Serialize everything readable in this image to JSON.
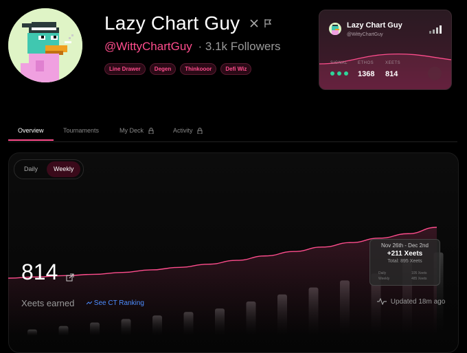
{
  "profile": {
    "name": "Lazy Chart Guy",
    "handle": "@WittyChartGuy",
    "followers": "· 3.1k Followers",
    "tags": [
      "Line Drawer",
      "Degen",
      "Thinkooor",
      "Defi Wiz"
    ],
    "icons": [
      "x-icon",
      "flag-icon"
    ]
  },
  "card": {
    "name": "Lazy Chart Guy",
    "handle": "@WittyChartGuy",
    "labels": {
      "signal": "SIGNAL",
      "ethos": "ETHOS",
      "xeets": "XEETS"
    },
    "ethos": "1368",
    "xeets": "814",
    "colors": {
      "signal": "#2fd59a",
      "accent": "#ff4d8d"
    }
  },
  "tabs": [
    {
      "label": "Overview",
      "active": true
    },
    {
      "label": "Tournaments",
      "active": false
    },
    {
      "label": "My Deck",
      "locked": true
    },
    {
      "label": "Activity",
      "locked": true
    }
  ],
  "toggle": {
    "daily": "Daily",
    "weekly": "Weekly",
    "selected": "Weekly"
  },
  "stats": {
    "value": "814",
    "label": "Xeets earned",
    "rank_link": "See CT Ranking",
    "updated": "Updated 18m ago"
  },
  "tooltip": {
    "range": "Nov 26th - Dec 2nd",
    "delta": "+211 Xeets",
    "total": "Total: 895 Xeets",
    "daily_label": "Daily",
    "daily_value": "105 Xeets",
    "weekly_label": "Weekly",
    "weekly_value": "485 Xeets"
  },
  "chart_data": {
    "type": "bar",
    "series": [
      {
        "values": [
          2,
          3,
          4,
          5,
          6,
          7,
          8,
          10,
          12,
          14,
          16,
          18,
          22,
          24,
          30,
          40
        ]
      }
    ],
    "highlight_index": 14,
    "line_values": [
      0,
      0.4,
      0.8,
      1.2,
      1.8,
      2.6,
      3.4,
      4.4,
      5.6,
      7.0,
      8.4,
      9.8,
      11.2,
      12.6,
      14.0,
      16.0
    ]
  }
}
